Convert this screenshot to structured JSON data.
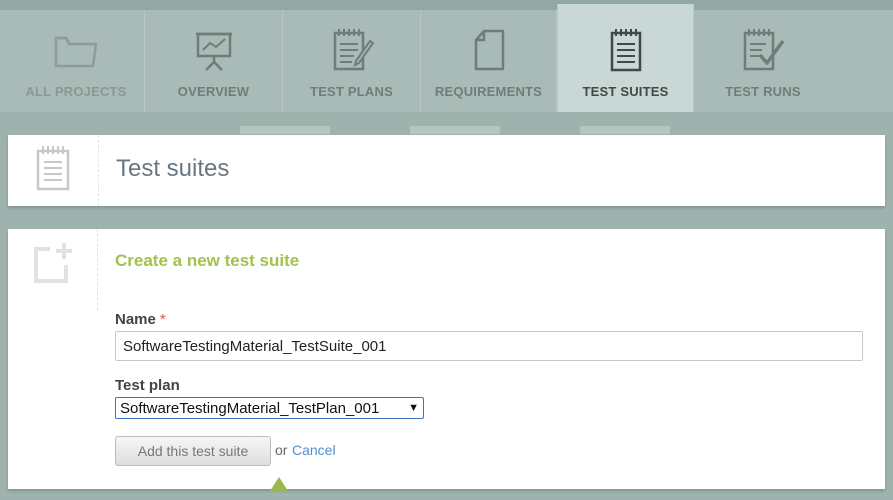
{
  "nav": {
    "tabs": [
      {
        "label": "ALL PROJECTS",
        "icon": "folder-icon",
        "active": false
      },
      {
        "label": "OVERVIEW",
        "icon": "presentation-icon",
        "active": false
      },
      {
        "label": "TEST PLANS",
        "icon": "notepad-pencil-icon",
        "active": false
      },
      {
        "label": "REQUIREMENTS",
        "icon": "document-icon",
        "active": false
      },
      {
        "label": "TEST SUITES",
        "icon": "notepad-icon",
        "active": true
      },
      {
        "label": "TEST RUNS",
        "icon": "notepad-check-icon",
        "active": false
      }
    ]
  },
  "page": {
    "title": "Test suites",
    "icon": "notepad-icon"
  },
  "form": {
    "heading": "Create a new test suite",
    "icon": "add-box-icon",
    "name_label": "Name",
    "required_mark": "*",
    "name_value": "SoftwareTestingMaterial_TestSuite_001",
    "test_plan_label": "Test plan",
    "test_plan_selected": "SoftwareTestingMaterial_TestPlan_001",
    "test_plan_arrow": "▼",
    "submit_label": "Add this test suite",
    "or_text": "or",
    "cancel_label": "Cancel"
  },
  "colors": {
    "accent_green": "#a3c24b",
    "link_blue": "#4f8fd1",
    "nav_bg": "#a8bbb6",
    "active_tab": "#c9d8d4"
  }
}
